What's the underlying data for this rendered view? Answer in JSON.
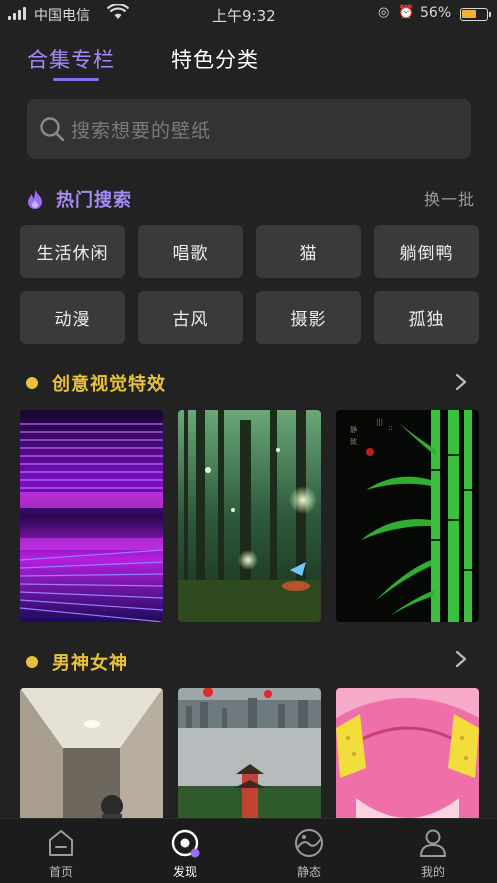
{
  "status_bar": {
    "carrier": "中国电信",
    "time": "上午9:32",
    "battery": "56%"
  },
  "tabs": [
    {
      "label": "合集专栏",
      "active": true
    },
    {
      "label": "特色分类",
      "active": false
    }
  ],
  "search": {
    "placeholder": "搜索想要的壁纸"
  },
  "hot_search": {
    "title": "热门搜索",
    "refresh_label": "换一批",
    "tags": [
      "生活休闲",
      "唱歌",
      "猫",
      "躺倒鸭",
      "动漫",
      "古风",
      "摄影",
      "孤独"
    ]
  },
  "sections": [
    {
      "title": "创意视觉特效",
      "cards": [
        "neon-lines-wallpaper",
        "forest-glow-wallpaper",
        "bamboo-wallpaper"
      ]
    },
    {
      "title": "男神女神",
      "cards": [
        "hallway-person-wallpaper",
        "city-pagoda-wallpaper",
        "cartoon-girl-wallpaper"
      ]
    }
  ],
  "bottom_nav": [
    {
      "label": "首页",
      "icon": "home-icon",
      "active": false
    },
    {
      "label": "发现",
      "icon": "discover-icon",
      "active": true
    },
    {
      "label": "静态",
      "icon": "static-icon",
      "active": false
    },
    {
      "label": "我的",
      "icon": "profile-icon",
      "active": false
    }
  ],
  "colors": {
    "background": "#222222",
    "accent_purple": "#a78bf5",
    "accent_yellow": "#e8c23a",
    "tile": "#3a3a3a"
  }
}
